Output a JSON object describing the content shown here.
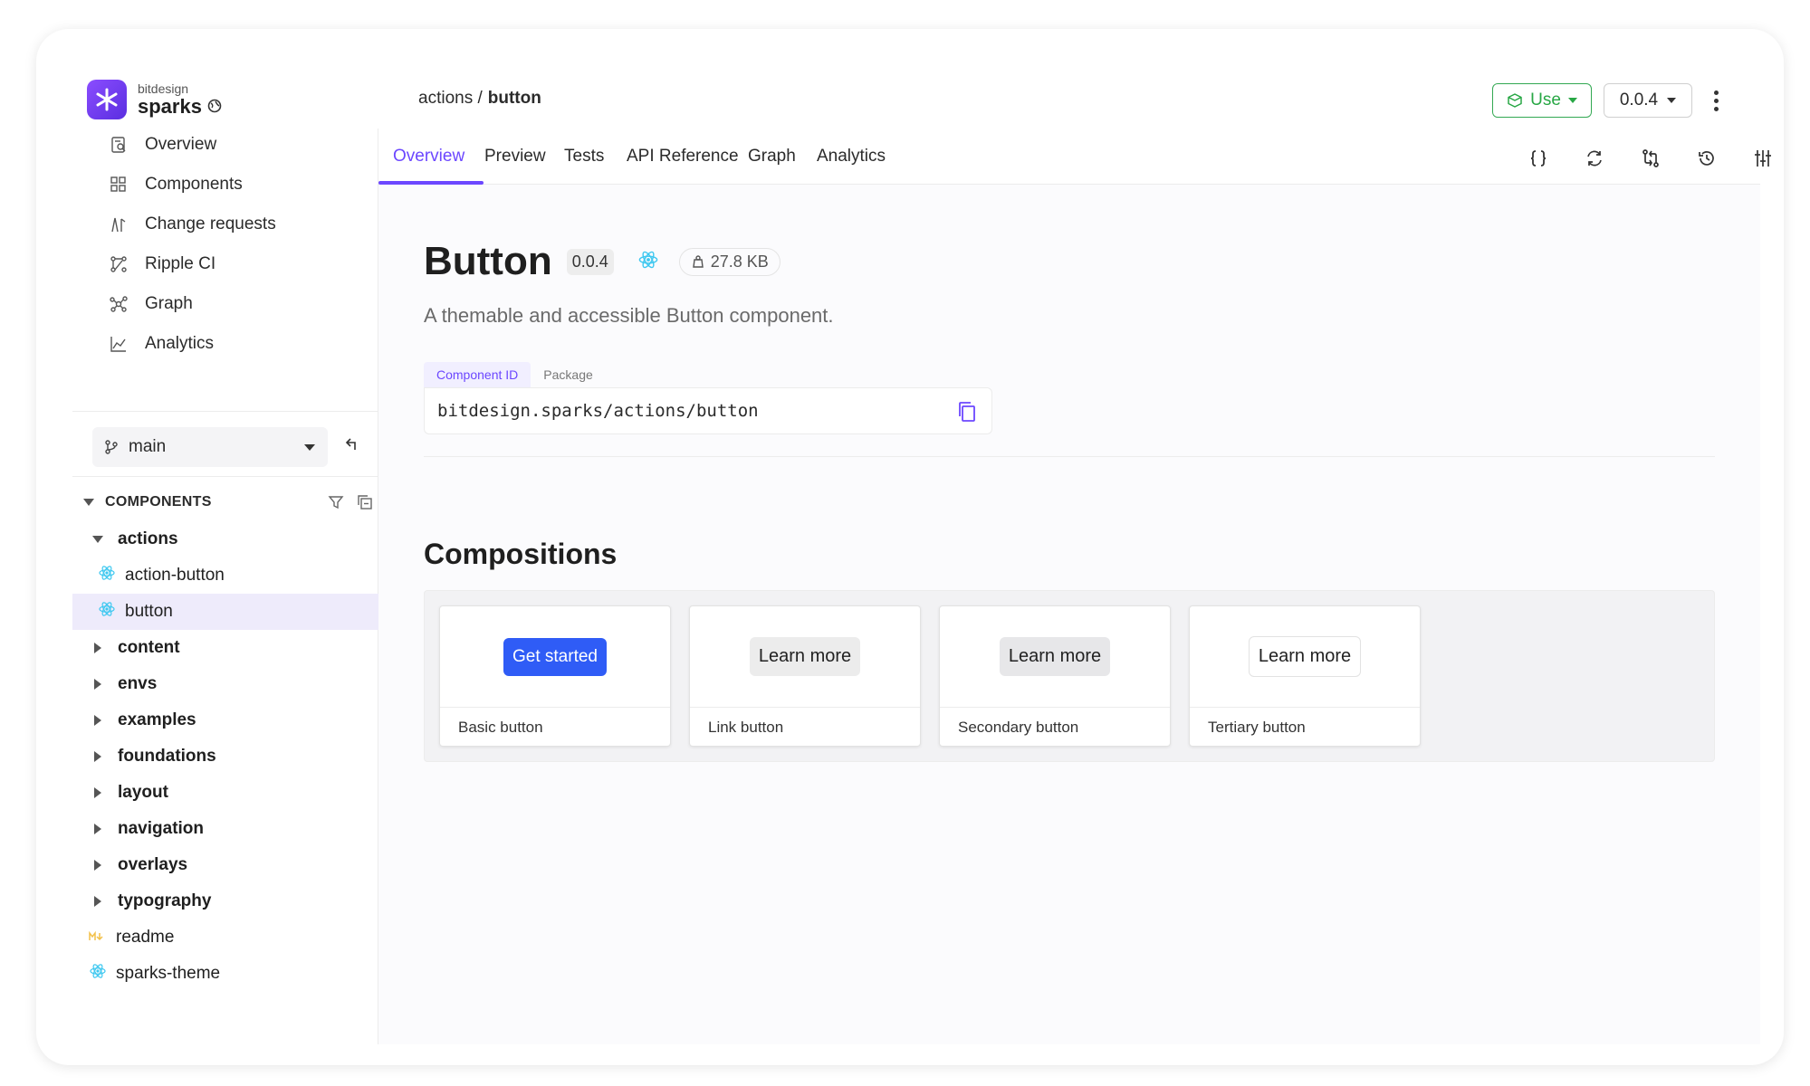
{
  "brand": {
    "org": "bitdesign",
    "name": "sparks",
    "accent": "#6c47ff"
  },
  "breadcrumb": {
    "path": "actions /",
    "current": "button"
  },
  "header": {
    "use_label": "Use",
    "version": "0.0.4"
  },
  "sidebar": {
    "nav": [
      {
        "label": "Overview",
        "icon": "overview-icon"
      },
      {
        "label": "Components",
        "icon": "grid-icon"
      },
      {
        "label": "Change requests",
        "icon": "change-requests-icon"
      },
      {
        "label": "Ripple CI",
        "icon": "ripple-ci-icon"
      },
      {
        "label": "Graph",
        "icon": "graph-icon"
      },
      {
        "label": "Analytics",
        "icon": "analytics-icon"
      }
    ],
    "branch": "main",
    "components_header": "COMPONENTS",
    "tree": [
      {
        "label": "actions",
        "type": "folder-open"
      },
      {
        "label": "action-button",
        "type": "component"
      },
      {
        "label": "button",
        "type": "component",
        "selected": true
      },
      {
        "label": "content",
        "type": "folder"
      },
      {
        "label": "envs",
        "type": "folder"
      },
      {
        "label": "examples",
        "type": "folder"
      },
      {
        "label": "foundations",
        "type": "folder"
      },
      {
        "label": "layout",
        "type": "folder"
      },
      {
        "label": "navigation",
        "type": "folder"
      },
      {
        "label": "overlays",
        "type": "folder"
      },
      {
        "label": "typography",
        "type": "folder"
      },
      {
        "label": "readme",
        "type": "markdown"
      },
      {
        "label": "sparks-theme",
        "type": "component"
      }
    ]
  },
  "tabs": [
    {
      "label": "Overview",
      "active": true
    },
    {
      "label": "Preview"
    },
    {
      "label": "Tests"
    },
    {
      "label": "API Reference"
    },
    {
      "label": "Graph"
    },
    {
      "label": "Analytics"
    }
  ],
  "toolbar_icons": [
    "code-braces-icon",
    "refresh-icon",
    "compare-icon",
    "history-icon",
    "settings-sliders-icon"
  ],
  "component": {
    "title": "Button",
    "version": "0.0.4",
    "size": "27.8 KB",
    "description": "A themable and accessible Button component.",
    "id_tabs": [
      "Component ID",
      "Package"
    ],
    "id_value": "bitdesign.sparks/actions/button"
  },
  "compositions": {
    "title": "Compositions",
    "cards": [
      {
        "button": "Get started",
        "label": "Basic button"
      },
      {
        "button": "Learn more",
        "label": "Link button"
      },
      {
        "button": "Learn more",
        "label": "Secondary button"
      },
      {
        "button": "Learn more",
        "label": "Tertiary button"
      }
    ]
  }
}
